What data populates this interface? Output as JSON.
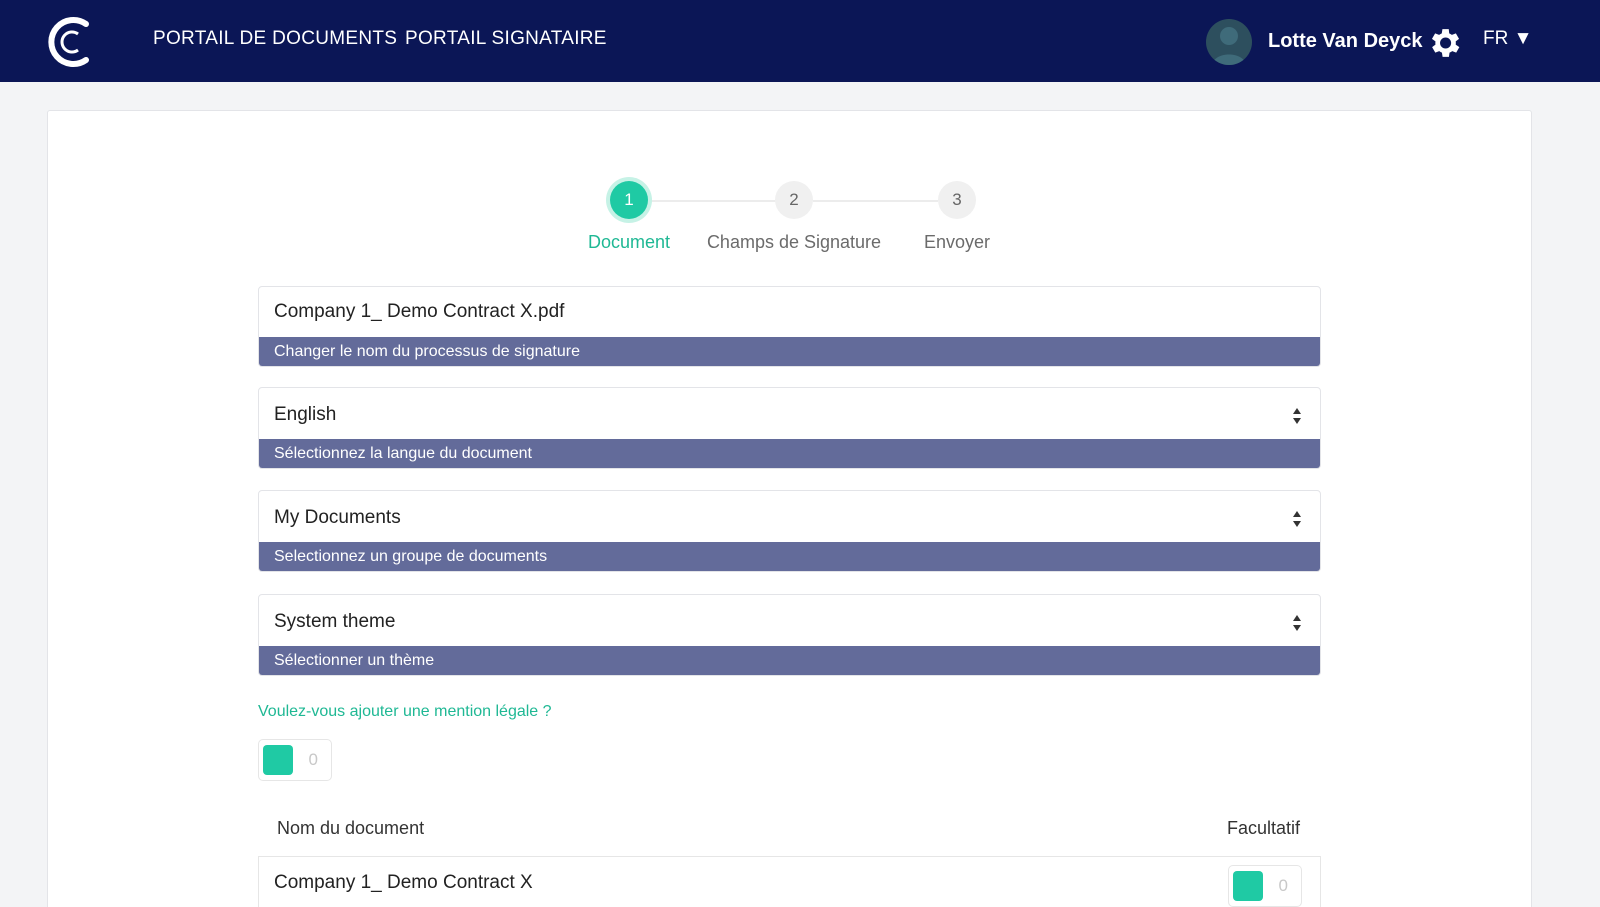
{
  "header": {
    "nav": {
      "documents_portal": "PORTAIL DE DOCUMENTS",
      "signer_portal": "PORTAIL SIGNATAIRE"
    },
    "user": {
      "name": "Lotte Van Deyck"
    },
    "language": "FR ▼"
  },
  "stepper": {
    "steps": [
      {
        "number": "1",
        "label": "Document"
      },
      {
        "number": "2",
        "label": "Champs de Signature"
      },
      {
        "number": "3",
        "label": "Envoyer"
      }
    ],
    "active_step": 1
  },
  "form": {
    "process_name": {
      "value": "Company 1_ Demo Contract X.pdf",
      "help": "Changer le nom du processus de signature"
    },
    "language": {
      "value": "English",
      "help": "Sélectionnez la langue du document"
    },
    "group": {
      "value": "My Documents",
      "help": "Selectionnez un groupe de documents"
    },
    "theme": {
      "value": "System theme",
      "help": "Sélectionner un thème"
    },
    "legal_mention": {
      "question": "Voulez-vous ajouter une mention légale ?",
      "toggle_value": "0"
    }
  },
  "documents_table": {
    "columns": {
      "name": "Nom du document",
      "optional": "Facultatif"
    },
    "rows": [
      {
        "name": "Company 1_ Demo Contract X",
        "optional_value": "0"
      }
    ]
  },
  "colors": {
    "header_bg": "#0b1656",
    "accent": "#1fcaa4",
    "help_bar": "#636b9a"
  }
}
